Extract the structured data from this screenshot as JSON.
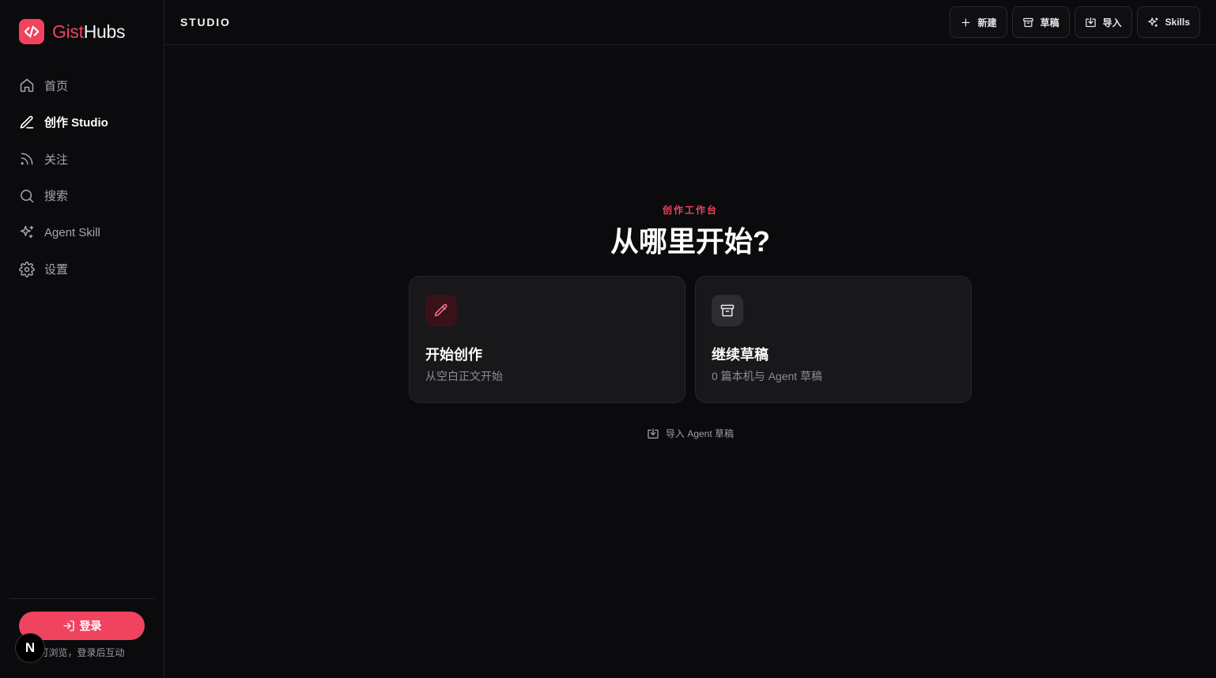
{
  "brand": {
    "part1": "Gist",
    "part2": "Hubs",
    "color": "#f0435f"
  },
  "sidebar": {
    "items": [
      {
        "label": "首页",
        "icon": "home-icon",
        "active": false
      },
      {
        "label": "创作 Studio",
        "icon": "pen-icon",
        "active": true
      },
      {
        "label": "关注",
        "icon": "rss-icon",
        "active": false
      },
      {
        "label": "搜索",
        "icon": "search-icon",
        "active": false
      },
      {
        "label": "Agent Skill",
        "icon": "sparkles-icon",
        "active": false
      },
      {
        "label": "设置",
        "icon": "gear-icon",
        "active": false
      }
    ],
    "login_label": "登录",
    "login_note": "可浏览，登录后互动",
    "avatar_letter": "N"
  },
  "header": {
    "title": "STUDIO",
    "buttons": [
      {
        "label": "新建",
        "icon": "plus-icon"
      },
      {
        "label": "草稿",
        "icon": "archive-icon"
      },
      {
        "label": "导入",
        "icon": "import-icon"
      },
      {
        "label": "Skills",
        "icon": "sparkles-icon"
      }
    ]
  },
  "main": {
    "eyebrow": "创作工作台",
    "title": "从哪里开始?",
    "cards": [
      {
        "title": "开始创作",
        "subtitle": "从空白正文开始",
        "icon": "pencil-icon"
      },
      {
        "title": "继续草稿",
        "subtitle": "0 篇本机与 Agent 草稿",
        "icon": "archive-icon"
      }
    ],
    "import_label": "导入 Agent 草稿"
  }
}
